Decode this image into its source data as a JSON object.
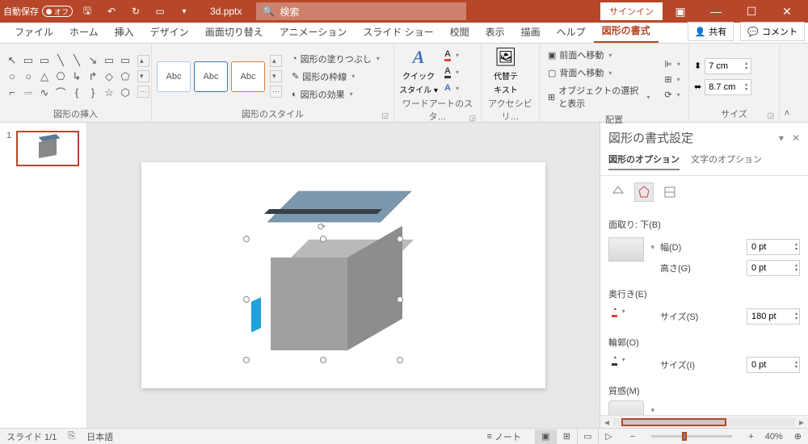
{
  "titlebar": {
    "autosave_label": "自動保存",
    "autosave_state": "オフ",
    "filename": "3d.pptx",
    "search_placeholder": "検索",
    "signin": "サインイン"
  },
  "tabs": {
    "items": [
      "ファイル",
      "ホーム",
      "挿入",
      "デザイン",
      "画面切り替え",
      "アニメーション",
      "スライド ショー",
      "校閲",
      "表示",
      "描画",
      "ヘルプ",
      "図形の書式"
    ],
    "active_index": 11,
    "share": "共有",
    "comment": "コメント"
  },
  "ribbon": {
    "insert_shapes": {
      "label": "図形の挿入"
    },
    "shape_styles": {
      "label": "図形のスタイル",
      "sample": "Abc",
      "fill": "図形の塗りつぶし",
      "outline": "図形の枠線",
      "effects": "図形の効果"
    },
    "wordart": {
      "label": "ワードアートのスタ…",
      "quick": "クイック",
      "styles": "スタイル"
    },
    "accessibility": {
      "label": "アクセシビリ…",
      "alt1": "代替テ",
      "alt2": "キスト"
    },
    "arrange": {
      "label": "配置",
      "bring_forward": "前面へ移動",
      "send_backward": "背面へ移動",
      "selection_pane": "オブジェクトの選択と表示"
    },
    "size": {
      "label": "サイズ",
      "height": "7 cm",
      "width": "8.7 cm"
    }
  },
  "thumbnails": {
    "slide1_num": "1"
  },
  "format_pane": {
    "title": "図形の書式設定",
    "tab_shape": "図形のオプション",
    "tab_text": "文字のオプション",
    "bevel_bottom": "面取り: 下(B)",
    "width_label": "幅(D)",
    "width_value": "0 pt",
    "height_label": "高さ(G)",
    "height_value": "0 pt",
    "depth": "奥行き(E)",
    "size_label": "サイズ(S)",
    "size_value": "180 pt",
    "contour": "輪郭(O)",
    "size2_label": "サイズ(I)",
    "size2_value": "0 pt",
    "material": "質感(M)"
  },
  "statusbar": {
    "slide": "スライド 1/1",
    "lang": "日本語",
    "notes": "ノート",
    "zoom": "40%"
  }
}
